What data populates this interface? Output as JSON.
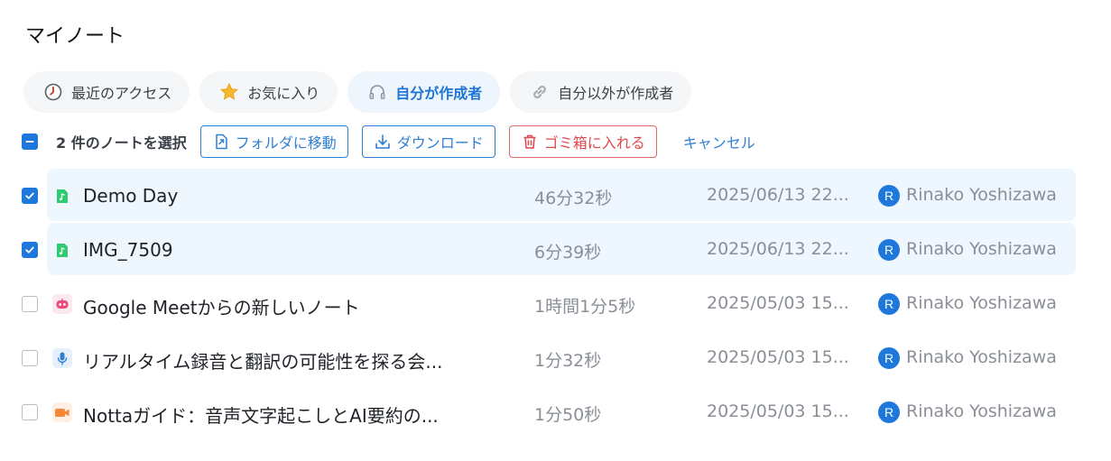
{
  "page": {
    "title": "マイノート"
  },
  "tabs": [
    {
      "label": "最近のアクセス",
      "icon": "clock-icon"
    },
    {
      "label": "お気に入り",
      "icon": "star-icon"
    },
    {
      "label": "自分が作成者",
      "icon": "headphones-icon",
      "active": true
    },
    {
      "label": "自分以外が作成者",
      "icon": "link-icon"
    }
  ],
  "selection": {
    "count_label": "2 件のノートを選択",
    "move_label": "フォルダに移動",
    "download_label": "ダウンロード",
    "trash_label": "ゴミ箱に入れる",
    "cancel_label": "キャンセル"
  },
  "notes": [
    {
      "name": "Demo Day",
      "duration": "46分32秒",
      "date": "2025/06/13 22...",
      "avatar": "R",
      "owner": "Rinako Yoshizawa",
      "selected": true,
      "type": "audio-file-icon",
      "color": "#2ecc71"
    },
    {
      "name": "IMG_7509",
      "duration": "6分39秒",
      "date": "2025/06/13 22...",
      "avatar": "R",
      "owner": "Rinako Yoshizawa",
      "selected": true,
      "type": "audio-file-icon",
      "color": "#2ecc71"
    },
    {
      "name": "Google Meetからの新しいノート",
      "duration": "1時間1分5秒",
      "date": "2025/05/03 15...",
      "avatar": "R",
      "owner": "Rinako Yoshizawa",
      "selected": false,
      "type": "bot-icon",
      "color": "#e84a7a"
    },
    {
      "name": "リアルタイム録音と翻訳の可能性を探る会...",
      "duration": "1分32秒",
      "date": "2025/05/03 15...",
      "avatar": "R",
      "owner": "Rinako Yoshizawa",
      "selected": false,
      "type": "microphone-icon",
      "color": "#2f7fd4"
    },
    {
      "name": "Nottaガイド：音声文字起こしとAI要約の...",
      "duration": "1分50秒",
      "date": "2025/05/03 15...",
      "avatar": "R",
      "owner": "Rinako Yoshizawa",
      "selected": false,
      "type": "video-icon",
      "color": "#f5883b"
    }
  ]
}
